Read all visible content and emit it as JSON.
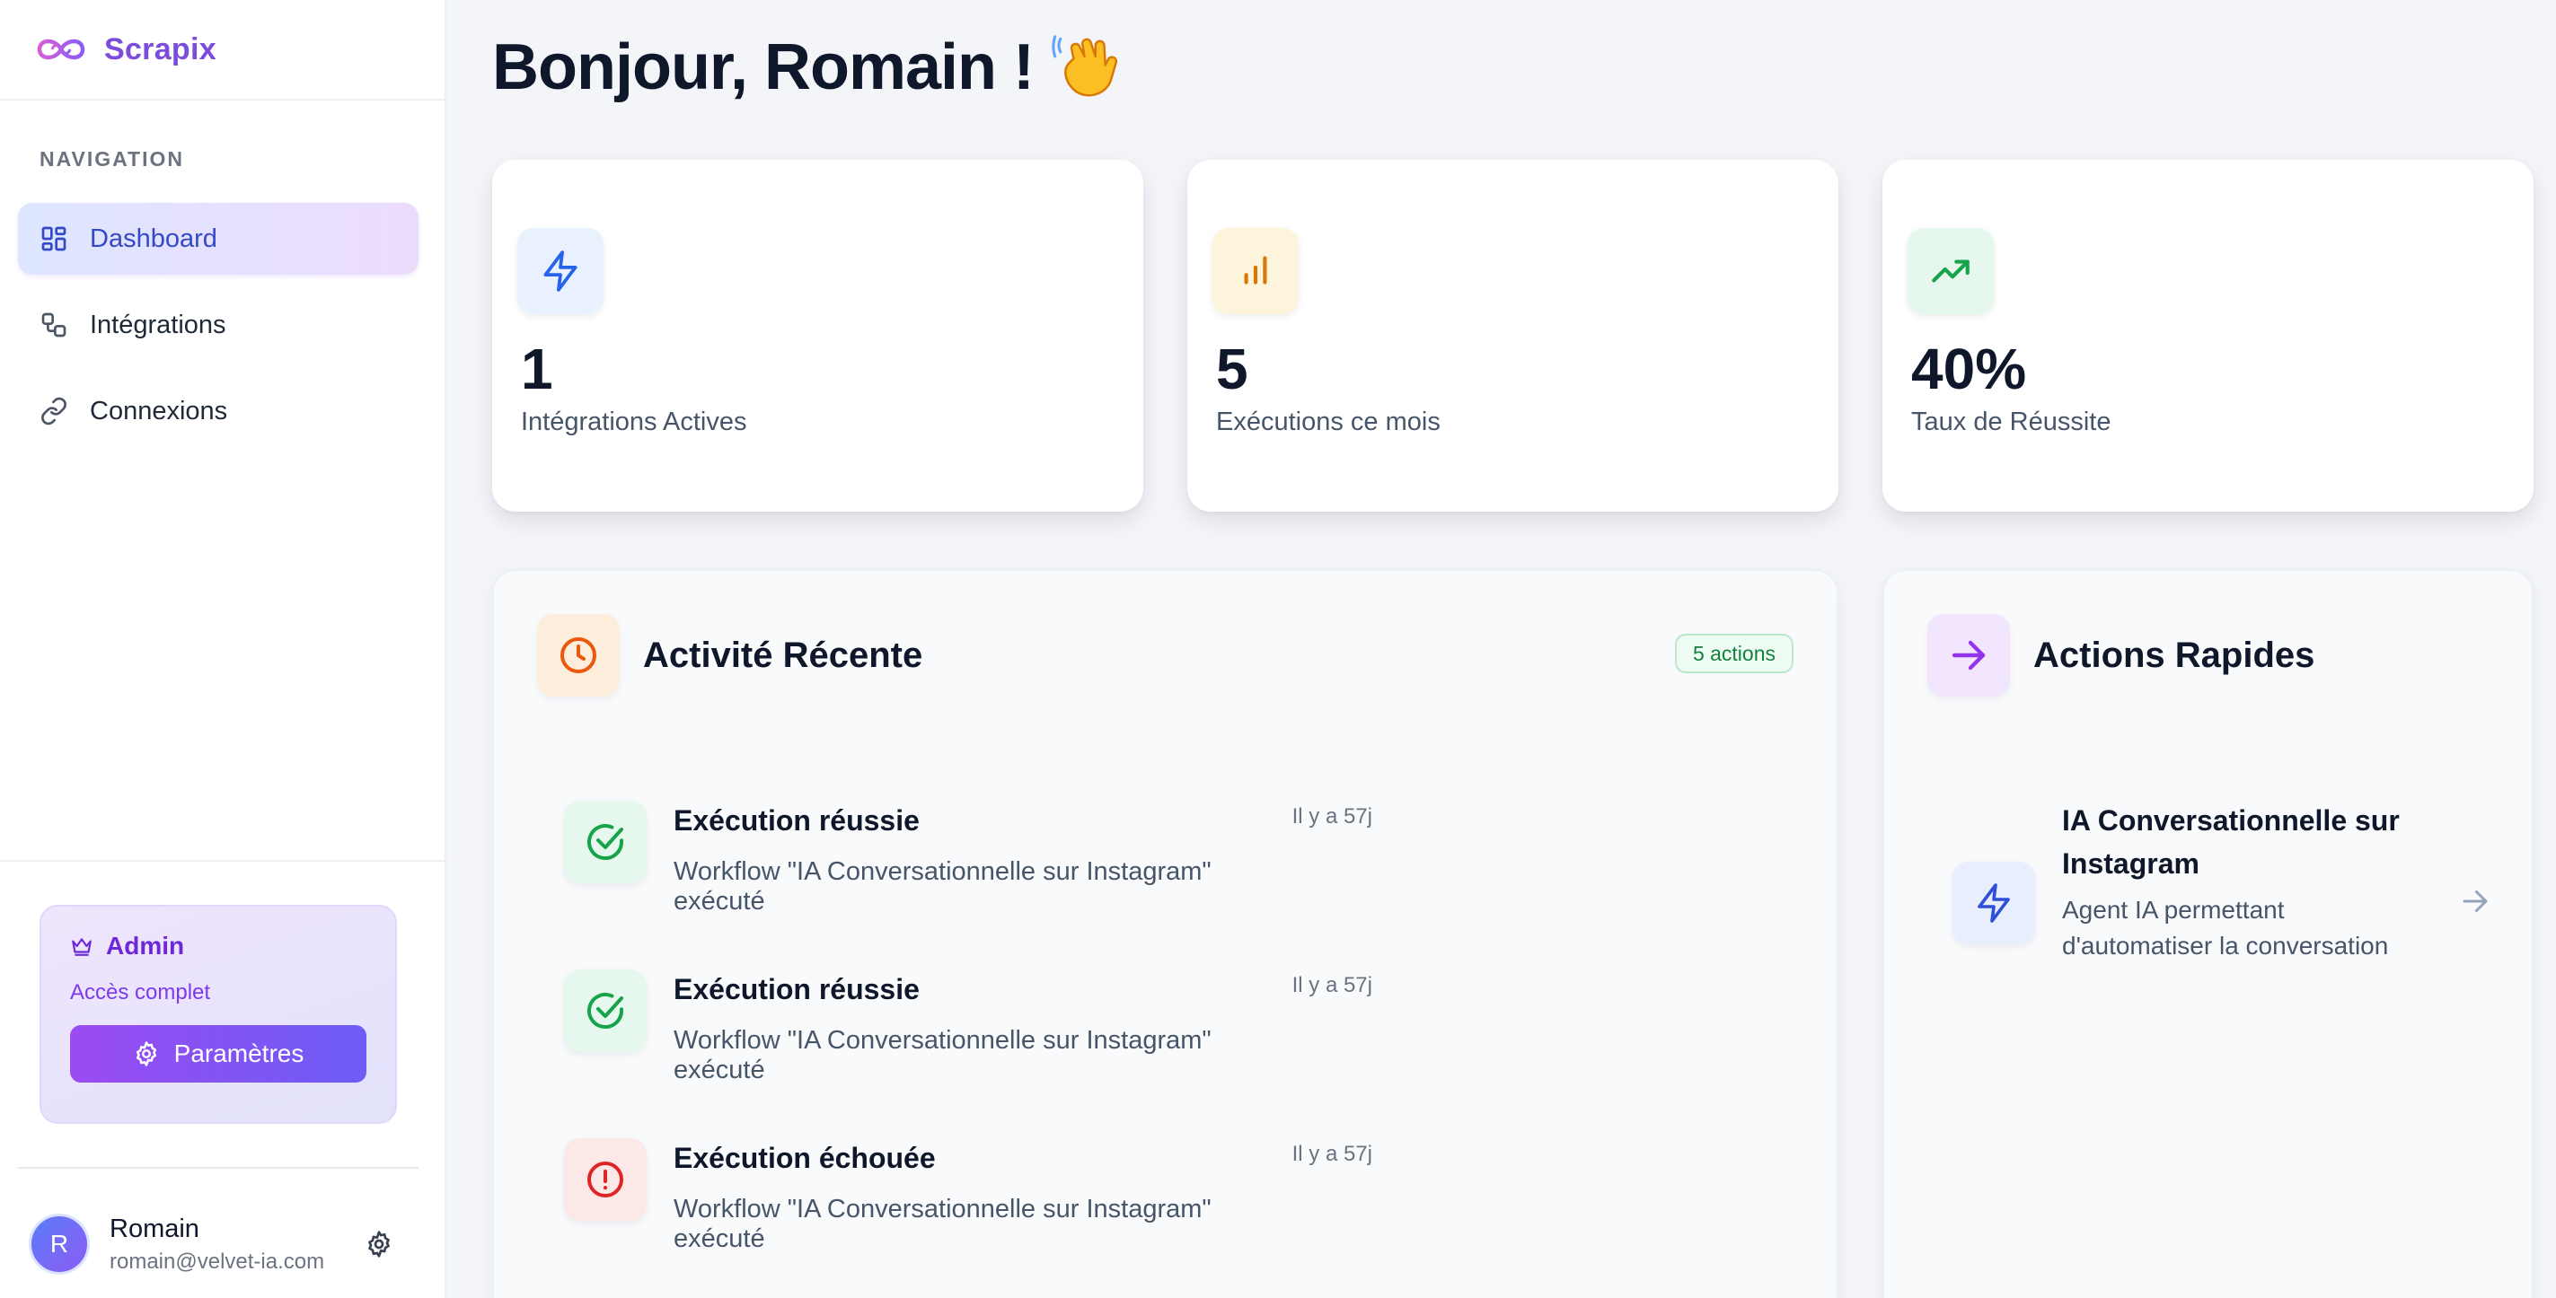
{
  "brand": {
    "name": "Scrapix",
    "logo_icon": "infinity-logo-icon",
    "color": "#7c4ddb"
  },
  "sidebar": {
    "section_title": "NAVIGATION",
    "items": [
      {
        "label": "Dashboard",
        "icon": "dashboard-grid-icon",
        "active": true
      },
      {
        "label": "Intégrations",
        "icon": "integrations-icon",
        "active": false
      },
      {
        "label": "Connexions",
        "icon": "link-icon",
        "active": false
      }
    ],
    "admin": {
      "title": "Admin",
      "icon": "crown-icon",
      "subtitle": "Accès complet",
      "button_label": "Paramètres",
      "button_icon": "gear-icon"
    },
    "user": {
      "initial": "R",
      "name": "Romain",
      "email": "romain@velvet-ia.com",
      "settings_icon": "gear-icon"
    }
  },
  "header": {
    "greeting": "Bonjour, Romain !",
    "emoji": "waving-hand-icon"
  },
  "stats": [
    {
      "value": "1",
      "label": "Intégrations Actives",
      "icon": "lightning-icon",
      "color": "#2563eb",
      "bg": "#e8f1fd"
    },
    {
      "value": "5",
      "label": "Exécutions ce mois",
      "icon": "bar-chart-icon",
      "color": "#d97706",
      "bg": "#fdf4dc"
    },
    {
      "value": "40%",
      "label": "Taux de Réussite",
      "icon": "trending-up-icon",
      "color": "#16a34a",
      "bg": "#e6f7ee"
    }
  ],
  "recent_activity": {
    "title": "Activité Récente",
    "icon": "clock-icon",
    "badge": "5 actions",
    "items": [
      {
        "title": "Exécution réussie",
        "description": "Workflow \"IA Conversationnelle sur Instagram\" exécuté",
        "time": "Il y a 57j",
        "status": "success",
        "icon": "check-circle-icon"
      },
      {
        "title": "Exécution réussie",
        "description": "Workflow \"IA Conversationnelle sur Instagram\" exécuté",
        "time": "Il y a 57j",
        "status": "success",
        "icon": "check-circle-icon"
      },
      {
        "title": "Exécution échouée",
        "description": "Workflow \"IA Conversationnelle sur Instagram\" exécuté",
        "time": "Il y a 57j",
        "status": "error",
        "icon": "alert-circle-icon"
      }
    ]
  },
  "quick_actions": {
    "title": "Actions Rapides",
    "icon": "arrow-right-icon",
    "items": [
      {
        "title": "IA Conversationnelle sur Instagram",
        "description": "Agent IA permettant d'automatiser la conversation",
        "icon": "lightning-icon",
        "arrow_icon": "arrow-right-icon"
      }
    ]
  },
  "colors": {
    "success": "#16a34a",
    "error": "#dc2626",
    "accent": "#7c3aed",
    "primary_blue": "#3349c7"
  }
}
